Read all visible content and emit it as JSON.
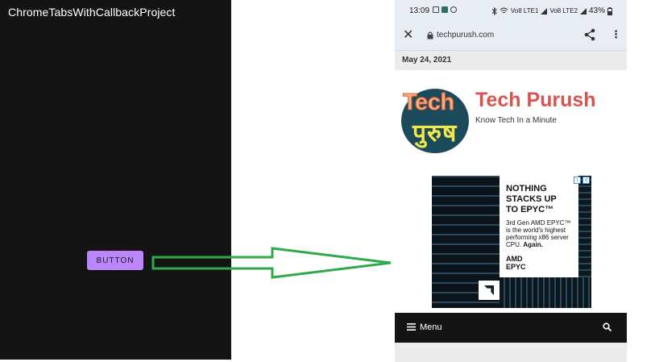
{
  "app": {
    "title": "ChromeTabsWithCallbackProject",
    "button_label": "BUTTON"
  },
  "phone": {
    "status": {
      "time": "13:09",
      "net1": "Vo8 LTE1",
      "net2": "Vo8 LTE2",
      "battery": "43%"
    },
    "browser": {
      "close_icon": "close-icon",
      "url": "techpurush.com",
      "share_icon": "share-icon",
      "menu_icon": "more-vert-icon"
    },
    "date": "May 24, 2021",
    "site": {
      "logo_en": "Tech",
      "logo_hi": "पुरुष",
      "name": "Tech Purush",
      "tagline": "Know Tech In a Minute"
    },
    "ad": {
      "headline_1": "NOTHING",
      "headline_2": "STACKS UP",
      "headline_3": "TO EPYC™",
      "body_1": "3rd Gen AMD EPYC™",
      "body_2": "is the world's highest",
      "body_3": "performing x86 server",
      "body_4": "CPU.",
      "body_bold": "Again.",
      "brand_1": "AMD",
      "brand_2": "EPYC",
      "badge_info": "i",
      "badge_close": "x"
    },
    "menu": {
      "label": "Menu"
    }
  },
  "colors": {
    "app_background": "#141414",
    "button": "#bb86fc",
    "arrow": "#2eaa4a",
    "brand_red": "#d9534f"
  }
}
